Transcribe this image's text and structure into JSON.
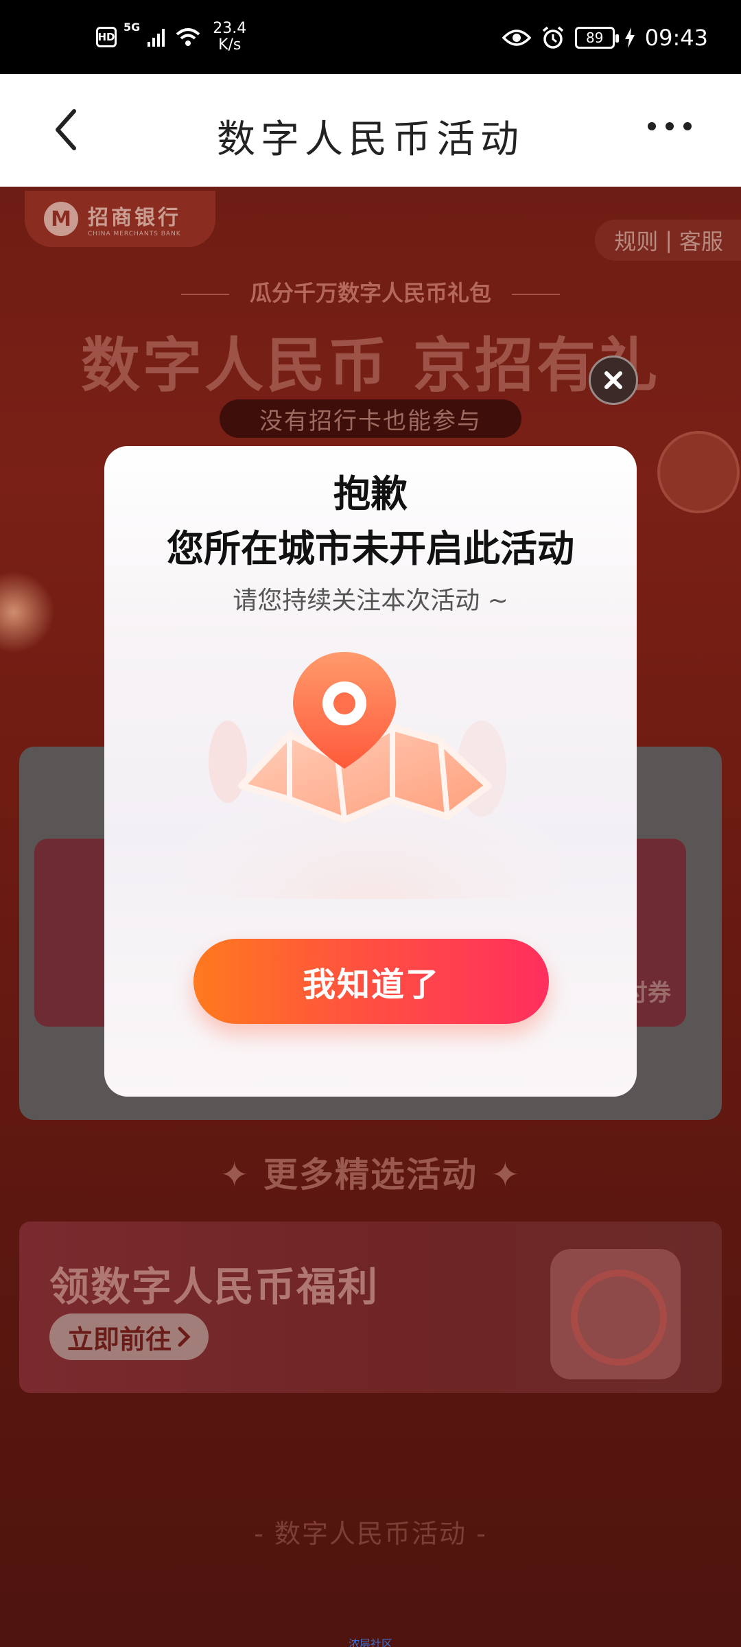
{
  "status_bar": {
    "hd": "HD",
    "network": "5G",
    "speed_value": "23.4",
    "speed_unit": "K/s",
    "battery": "89",
    "time": "09:43"
  },
  "nav": {
    "title": "数字人民币活动"
  },
  "background": {
    "bank_name": "招商银行",
    "bank_name_en": "CHINA MERCHANTS BANK",
    "rules": "规则",
    "service": "客服",
    "sub_slogan": "瓜分千万数字人民币礼包",
    "main_slogan": "数字人民币 京招有礼",
    "pill": "没有招行卡也能参与",
    "ticket_text": "付券",
    "more_title": "更多精选活动",
    "banner_title": "领数字人民币福利",
    "banner_button": "立即前往",
    "footer": "- 数字人民币活动 -",
    "footer_link": "浓层社区"
  },
  "modal": {
    "title_line1": "抱歉",
    "title_line2": "您所在城市未开启此活动",
    "subtitle": "请您持续关注本次活动 ~",
    "button": "我知道了"
  },
  "colors": {
    "accent_start": "#ff7a1e",
    "accent_end": "#ff2f5e",
    "page_bg": "#6e1d14"
  }
}
